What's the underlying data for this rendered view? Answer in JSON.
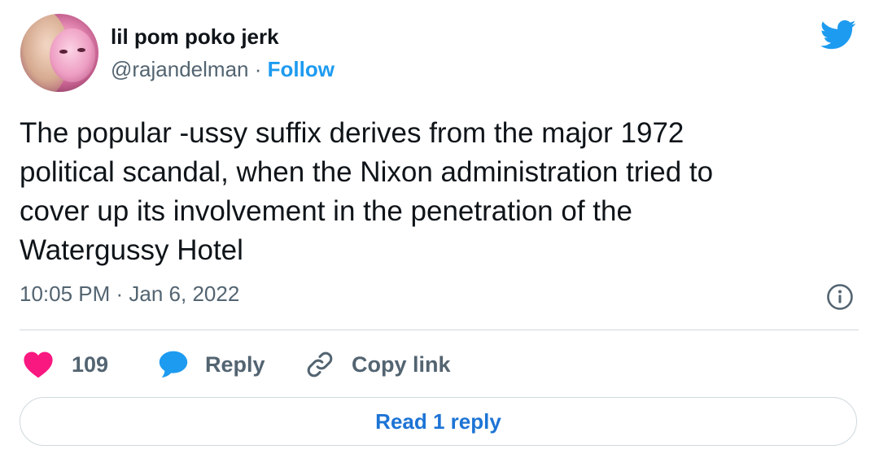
{
  "author": {
    "display_name": "lil pom poko jerk",
    "handle": "@rajandelman",
    "separator": "·",
    "follow_label": "Follow"
  },
  "tweet": {
    "text_lines": [
      "The popular -ussy suffix derives from the major 1972",
      "political scandal, when the Nixon administration tried to",
      "cover up its involvement in the penetration of the",
      "Watergussy Hotel"
    ],
    "timestamp": "10:05 PM · Jan 6, 2022"
  },
  "actions": {
    "like_count": "109",
    "reply_label": "Reply",
    "copy_link_label": "Copy link"
  },
  "read_replies_label": "Read 1 reply",
  "icons": {
    "brand": "twitter-bird-icon",
    "info": "info-icon",
    "like": "heart-icon",
    "reply": "speech-bubble-icon",
    "copy": "link-icon"
  },
  "colors": {
    "brand_blue": "#1d9bf0",
    "like_pink": "#f91880",
    "link_blue": "#1d74d5",
    "muted_text": "#536471",
    "main_text": "#0f1419"
  }
}
